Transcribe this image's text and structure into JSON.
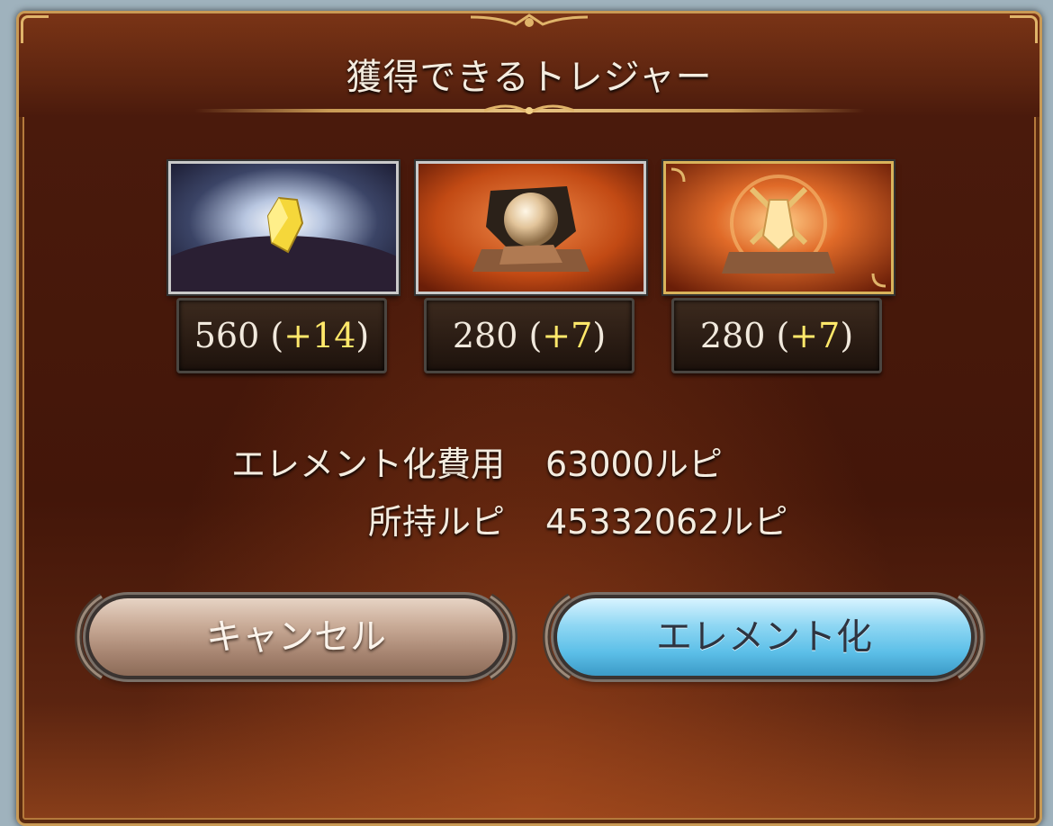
{
  "dialog": {
    "title": "獲得できるトレジャー"
  },
  "treasures": [
    {
      "name_icon": "yellow-crystal-icon",
      "base": "560",
      "bonus": "+14"
    },
    {
      "name_icon": "orb-in-rock-icon",
      "base": "280",
      "bonus": "+7"
    },
    {
      "name_icon": "crystal-in-rock-icon",
      "base": "280",
      "bonus": "+7"
    }
  ],
  "info": {
    "cost_label": "エレメント化費用",
    "cost_value": "63000ルピ",
    "owned_label": "所持ルピ",
    "owned_value": "45332062ルピ"
  },
  "buttons": {
    "cancel_label": "キャンセル",
    "element_label": "エレメント化"
  },
  "colors": {
    "dialog_bg": "#4a1a0c",
    "frame_gold": "#c99a55",
    "bonus_yellow": "#ffe86a",
    "cancel_button": "#c9ab97",
    "element_button": "#8fd7f3"
  }
}
